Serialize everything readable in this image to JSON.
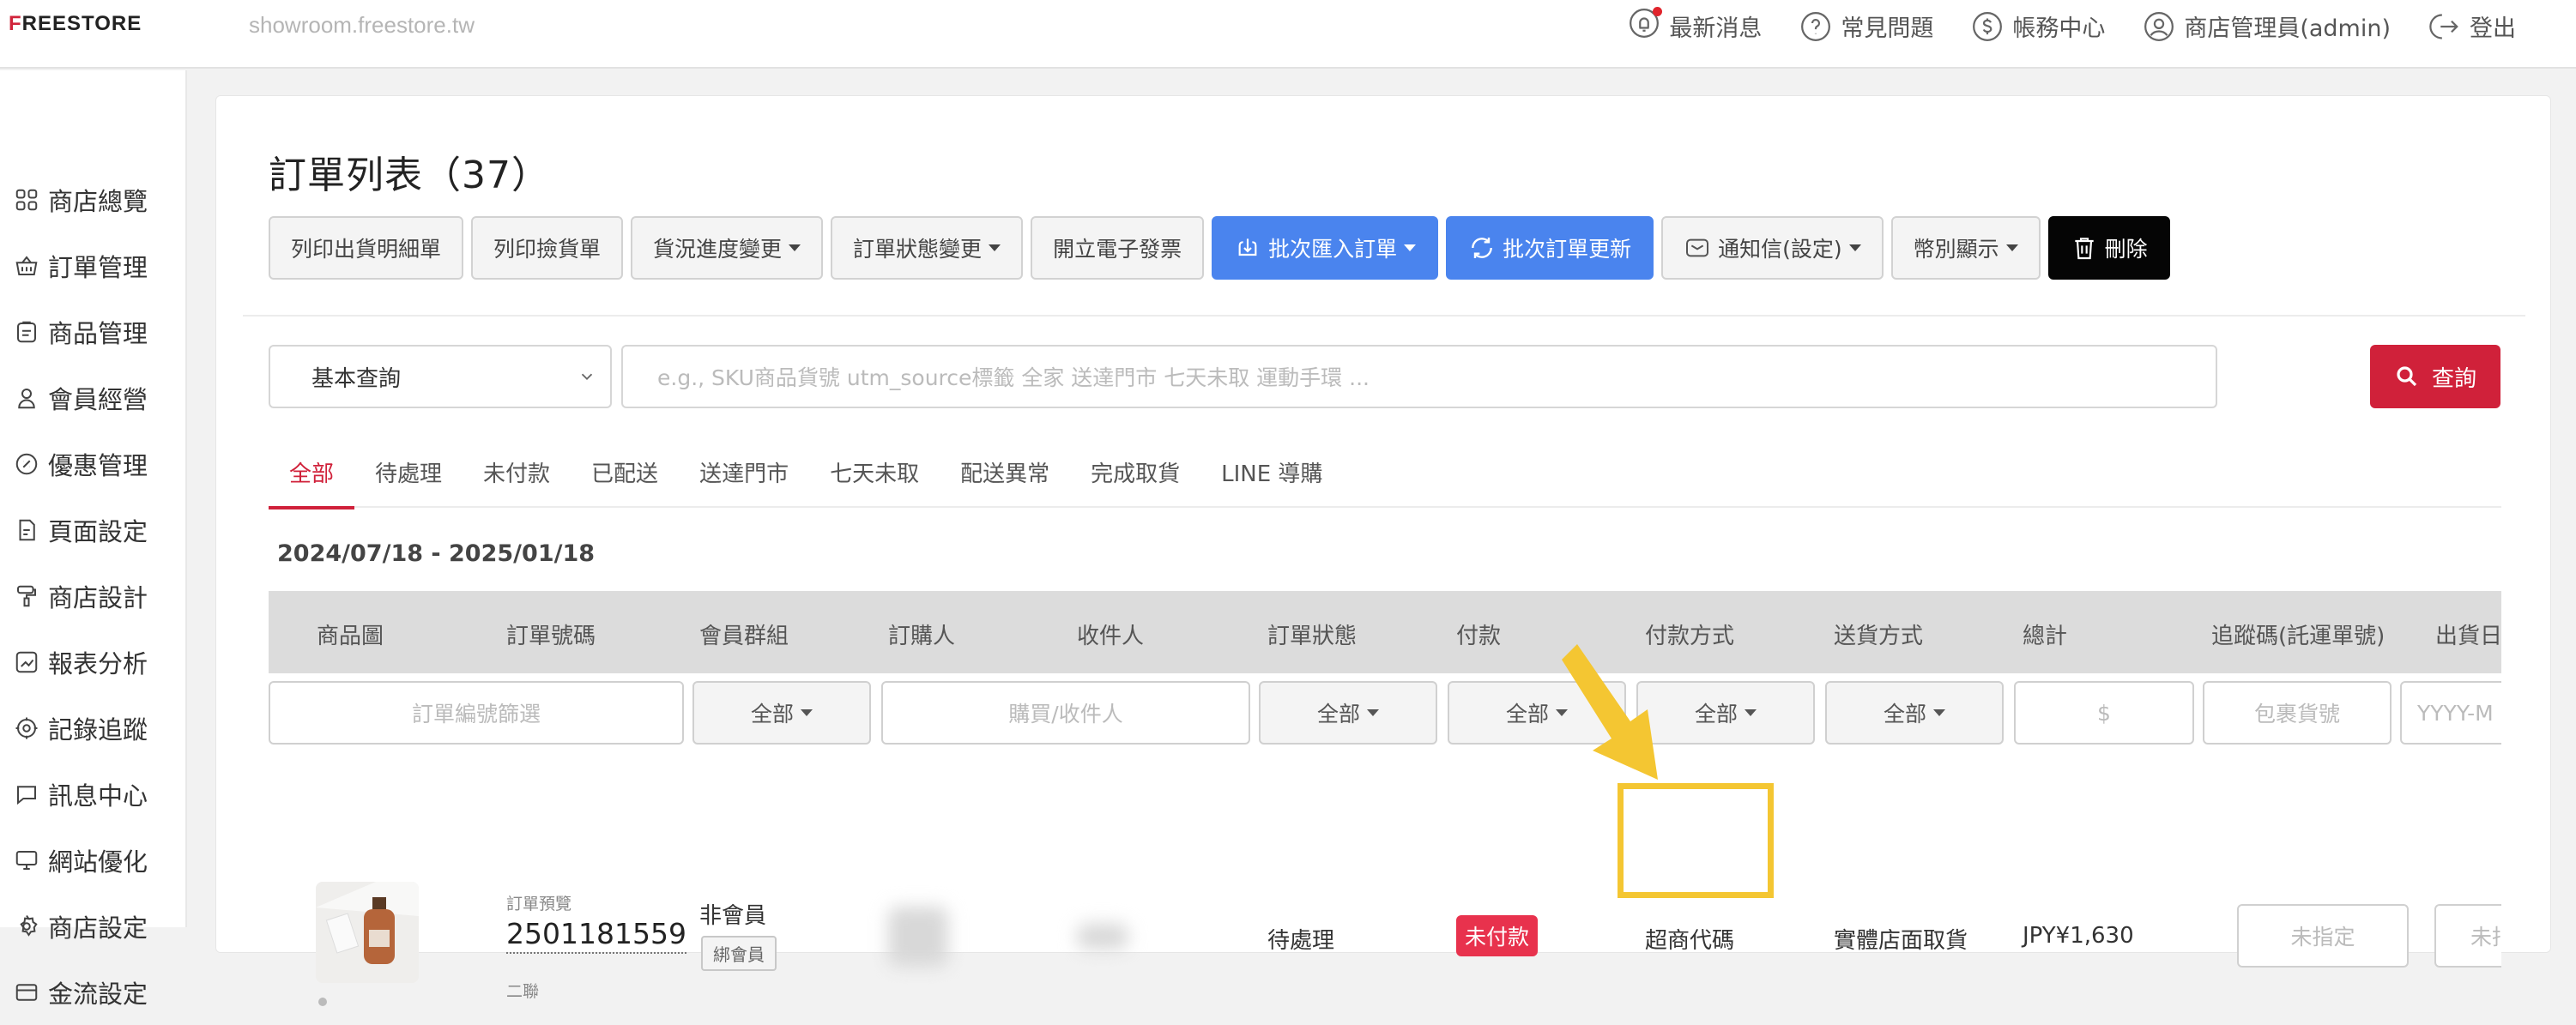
{
  "header": {
    "logo_prefix": "F",
    "logo_rest": "REESTORE",
    "domain": "showroom.freestore.tw",
    "nav": [
      {
        "label": "最新消息",
        "icon": "bell-icon"
      },
      {
        "label": "常見問題",
        "icon": "question-icon"
      },
      {
        "label": "帳務中心",
        "icon": "dollar-icon"
      },
      {
        "label": "商店管理員(admin)",
        "icon": "user-icon"
      },
      {
        "label": "登出",
        "icon": "logout-icon"
      }
    ]
  },
  "sidebar": {
    "items": [
      {
        "label": "商店總覽",
        "icon": "grid-icon"
      },
      {
        "label": "訂單管理",
        "icon": "basket-icon"
      },
      {
        "label": "商品管理",
        "icon": "clipboard-icon"
      },
      {
        "label": "會員經營",
        "icon": "person-icon"
      },
      {
        "label": "優惠管理",
        "icon": "coupon-icon"
      },
      {
        "label": "頁面設定",
        "icon": "page-icon"
      },
      {
        "label": "商店設計",
        "icon": "brush-icon"
      },
      {
        "label": "報表分析",
        "icon": "chart-icon"
      },
      {
        "label": "記錄追蹤",
        "icon": "target-icon"
      },
      {
        "label": "訊息中心",
        "icon": "message-icon"
      },
      {
        "label": "網站優化",
        "icon": "monitor-icon"
      },
      {
        "label": "商店設定",
        "icon": "gear-icon"
      },
      {
        "label": "金流設定",
        "icon": "card-icon"
      }
    ]
  },
  "main": {
    "title": "訂單列表（37）",
    "toolbar": {
      "print_packing": "列印出貨明細單",
      "print_picking": "列印撿貨單",
      "shipping_progress": "貨況進度變更",
      "order_status": "訂單狀態變更",
      "einvoice": "開立電子發票",
      "batch_import": "批次匯入訂單",
      "batch_update": "批次訂單更新",
      "notify": "通知信(設定)",
      "currency": "幣別顯示",
      "delete": "刪除"
    },
    "search": {
      "mode": "基本查詢",
      "placeholder": "e.g.,  SKU商品貨號    utm_source標籤    全家    送達門市    七天未取    運動手環  ...",
      "button": "查詢"
    },
    "tabs": [
      "全部",
      "待處理",
      "未付款",
      "已配送",
      "送達門市",
      "七天未取",
      "配送異常",
      "完成取貨",
      "LINE 導購"
    ],
    "active_tab": "全部",
    "date_range": "2024/07/18 - 2025/01/18",
    "columns": [
      "商品圖",
      "訂單號碼",
      "會員群組",
      "訂購人",
      "收件人",
      "訂單狀態",
      "付款",
      "付款方式",
      "送貨方式",
      "總計",
      "追蹤碼(託運單號)",
      "出貨日"
    ],
    "filters": {
      "order_no_placeholder": "訂單編號篩選",
      "member_group": "全部",
      "buyer_placeholder": "購買/收件人",
      "order_status": "全部",
      "payment": "全部",
      "payment_method": "全部",
      "shipping": "全部",
      "total_placeholder": "$",
      "tracking_placeholder": "包裹貨號",
      "date_placeholder": "YYYY-M"
    },
    "row": {
      "preview_label": "訂單預覽",
      "order_no": "2501181559",
      "invoice_type": "二聯",
      "member_group": "非會員",
      "bind_member": "綁會員",
      "order_status": "待處理",
      "payment": "未付款",
      "payment_method": "超商代碼",
      "shipping": "實體店面取貨",
      "total": "JPY¥1,630",
      "tracking": "未指定",
      "ship_date": "未指"
    }
  },
  "colors": {
    "brand_red": "#d0213a",
    "primary_blue": "#4a84ee",
    "unpaid_badge": "#e8324d",
    "highlight": "#f4c632"
  }
}
